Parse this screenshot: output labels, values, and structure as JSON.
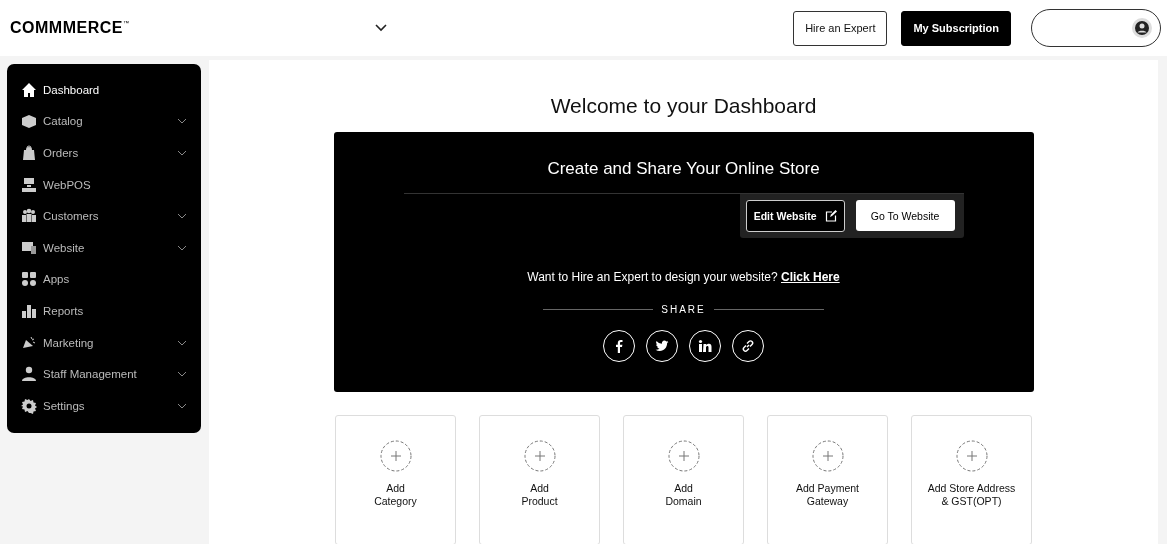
{
  "header": {
    "logo": "COMMMERCE",
    "logo_mark": "™",
    "buttons": [
      {
        "label": "Hire an Expert",
        "kind": "outline"
      },
      {
        "label": "My Subscription",
        "kind": "solid"
      }
    ]
  },
  "sidebar": {
    "items": [
      {
        "label": "Dashboard",
        "selected": true,
        "expandable": false
      },
      {
        "label": "Catalog",
        "selected": false,
        "expandable": true
      },
      {
        "label": "Orders",
        "selected": false,
        "expandable": true
      },
      {
        "label": "WebPOS",
        "selected": false,
        "expandable": false
      },
      {
        "label": "Customers",
        "selected": false,
        "expandable": true
      },
      {
        "label": "Website",
        "selected": false,
        "expandable": true
      },
      {
        "label": "Apps",
        "selected": false,
        "expandable": false
      },
      {
        "label": "Reports",
        "selected": false,
        "expandable": false
      },
      {
        "label": "Marketing",
        "selected": false,
        "expandable": true
      },
      {
        "label": "Staff Management",
        "selected": false,
        "expandable": true
      },
      {
        "label": "Settings",
        "selected": false,
        "expandable": true
      }
    ]
  },
  "main": {
    "title": "Welcome to your Dashboard",
    "store_panel": {
      "title": "Create and Share Your Online Store",
      "edit_button": "Edit Website",
      "go_button": "Go To Website",
      "hire_text": "Want to Hire an Expert to design your website?",
      "hire_link": "Click Here",
      "share_label": "SHARE"
    },
    "quick_actions": [
      {
        "lines": [
          "Add",
          "Category"
        ]
      },
      {
        "lines": [
          "Add",
          "Product"
        ]
      },
      {
        "lines": [
          "Add",
          "Domain"
        ]
      },
      {
        "lines": [
          "Add Payment",
          "Gateway"
        ]
      },
      {
        "lines": [
          "Add Store Address",
          "& GST(OPT)"
        ]
      }
    ]
  }
}
